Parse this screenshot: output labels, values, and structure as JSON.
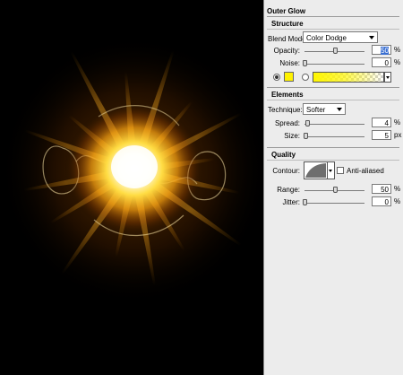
{
  "canvas": {
    "glow_core_color": "#fffbe0",
    "glow_mid_color": "#ffcc22",
    "glow_outer_color": "#c86a00",
    "background_color": "#000000"
  },
  "panel": {
    "title": "Outer Glow",
    "structure": {
      "title": "Structure",
      "blend_mode_label": "Blend Mode:",
      "blend_mode_value": "Color Dodge",
      "opacity_label": "Opacity:",
      "opacity_value": "50",
      "opacity_unit": "%",
      "opacity_level": 0.5,
      "noise_label": "Noise:",
      "noise_value": "0",
      "noise_unit": "%",
      "noise_level": 0.0,
      "solid_color": "#fff200",
      "gradient_color": "#fff600"
    },
    "elements": {
      "title": "Elements",
      "technique_label": "Technique:",
      "technique_value": "Softer",
      "spread_label": "Spread:",
      "spread_value": "4",
      "spread_unit": "%",
      "spread_level": 0.04,
      "size_label": "Size:",
      "size_value": "5",
      "size_unit": "px",
      "size_level": 0.02
    },
    "quality": {
      "title": "Quality",
      "contour_label": "Contour:",
      "anti_aliased_label": "Anti-aliased",
      "range_label": "Range:",
      "range_value": "50",
      "range_unit": "%",
      "range_level": 0.5,
      "jitter_label": "Jitter:",
      "jitter_value": "0",
      "jitter_unit": "%",
      "jitter_level": 0.0
    }
  }
}
